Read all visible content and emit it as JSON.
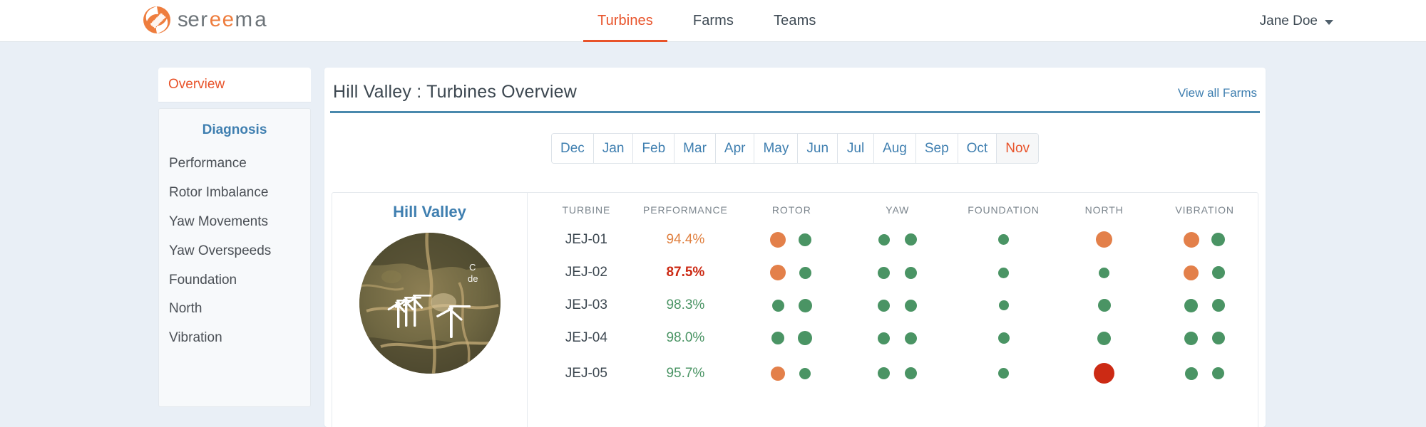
{
  "header": {
    "logo_name": "sereema",
    "nav": [
      {
        "label": "Turbines",
        "active": true
      },
      {
        "label": "Farms",
        "active": false
      },
      {
        "label": "Teams",
        "active": false
      }
    ],
    "user": {
      "name": "Jane Doe",
      "caret_icon": "chevron-down-icon"
    }
  },
  "sidebar": {
    "overview_label": "Overview",
    "section_title": "Diagnosis",
    "items": [
      {
        "label": "Performance"
      },
      {
        "label": "Rotor Imbalance"
      },
      {
        "label": "Yaw Movements"
      },
      {
        "label": "Yaw Overspeeds"
      },
      {
        "label": "Foundation"
      },
      {
        "label": "North"
      },
      {
        "label": "Vibration"
      }
    ]
  },
  "main": {
    "title": "Hill Valley : Turbines Overview",
    "view_all_label": "View all Farms",
    "months": [
      {
        "label": "Dec",
        "active": false
      },
      {
        "label": "Jan",
        "active": false
      },
      {
        "label": "Feb",
        "active": false
      },
      {
        "label": "Mar",
        "active": false
      },
      {
        "label": "Apr",
        "active": false
      },
      {
        "label": "May",
        "active": false
      },
      {
        "label": "Jun",
        "active": false
      },
      {
        "label": "Jul",
        "active": false
      },
      {
        "label": "Aug",
        "active": false
      },
      {
        "label": "Sep",
        "active": false
      },
      {
        "label": "Oct",
        "active": false
      },
      {
        "label": "Nov",
        "active": true
      }
    ],
    "farm": {
      "name": "Hill Valley",
      "map_icon": "satellite-map-thumbnail",
      "map_label_partial_1": "C",
      "map_label_partial_2": "de"
    },
    "table": {
      "columns": [
        "TURBINE",
        "PERFORMANCE",
        "ROTOR",
        "YAW",
        "FOUNDATION",
        "NORTH",
        "VIBRATION"
      ],
      "rows": [
        {
          "turbine": "JEJ-01",
          "performance": "94.4%",
          "performance_state": "warn",
          "rotor": [
            {
              "color": "orange",
              "size": 22
            },
            {
              "color": "green",
              "size": 18
            }
          ],
          "yaw": [
            {
              "color": "green",
              "size": 16
            },
            {
              "color": "green",
              "size": 17
            }
          ],
          "foundation": [
            {
              "color": "green",
              "size": 15
            }
          ],
          "north": [
            {
              "color": "orange",
              "size": 23
            }
          ],
          "vibration": [
            {
              "color": "orange",
              "size": 22
            },
            {
              "color": "green",
              "size": 19
            }
          ]
        },
        {
          "turbine": "JEJ-02",
          "performance": "87.5%",
          "performance_state": "bad",
          "rotor": [
            {
              "color": "orange",
              "size": 22
            },
            {
              "color": "green",
              "size": 17
            }
          ],
          "yaw": [
            {
              "color": "green",
              "size": 17
            },
            {
              "color": "green",
              "size": 17
            }
          ],
          "foundation": [
            {
              "color": "green",
              "size": 15
            }
          ],
          "north": [
            {
              "color": "green",
              "size": 15
            }
          ],
          "vibration": [
            {
              "color": "orange",
              "size": 21
            },
            {
              "color": "green",
              "size": 18
            }
          ]
        },
        {
          "turbine": "JEJ-03",
          "performance": "98.3%",
          "performance_state": "good",
          "rotor": [
            {
              "color": "green",
              "size": 17
            },
            {
              "color": "green",
              "size": 19
            }
          ],
          "yaw": [
            {
              "color": "green",
              "size": 17
            },
            {
              "color": "green",
              "size": 17
            }
          ],
          "foundation": [
            {
              "color": "green",
              "size": 14
            }
          ],
          "north": [
            {
              "color": "green",
              "size": 18
            }
          ],
          "vibration": [
            {
              "color": "green",
              "size": 19
            },
            {
              "color": "green",
              "size": 18
            }
          ]
        },
        {
          "turbine": "JEJ-04",
          "performance": "98.0%",
          "performance_state": "good",
          "rotor": [
            {
              "color": "green",
              "size": 18
            },
            {
              "color": "green",
              "size": 20
            }
          ],
          "yaw": [
            {
              "color": "green",
              "size": 17
            },
            {
              "color": "green",
              "size": 17
            }
          ],
          "foundation": [
            {
              "color": "green",
              "size": 16
            }
          ],
          "north": [
            {
              "color": "green",
              "size": 19
            }
          ],
          "vibration": [
            {
              "color": "green",
              "size": 19
            },
            {
              "color": "green",
              "size": 18
            }
          ]
        },
        {
          "turbine": "JEJ-05",
          "performance": "95.7%",
          "performance_state": "good",
          "rotor": [
            {
              "color": "orange",
              "size": 20
            },
            {
              "color": "green",
              "size": 16
            }
          ],
          "yaw": [
            {
              "color": "green",
              "size": 17
            },
            {
              "color": "green",
              "size": 17
            }
          ],
          "foundation": [
            {
              "color": "green",
              "size": 15
            }
          ],
          "north": [
            {
              "color": "red",
              "size": 29
            }
          ],
          "vibration": [
            {
              "color": "green",
              "size": 18
            },
            {
              "color": "green",
              "size": 17
            }
          ]
        }
      ]
    }
  },
  "colors": {
    "orange": "#e3804a",
    "green": "#4a9464",
    "red": "#cc2a14",
    "brand_orange": "#e8532a",
    "brand_blue": "#3f7fb0",
    "rule_blue": "#4a89ad",
    "page_bg": "#e9eff6"
  }
}
